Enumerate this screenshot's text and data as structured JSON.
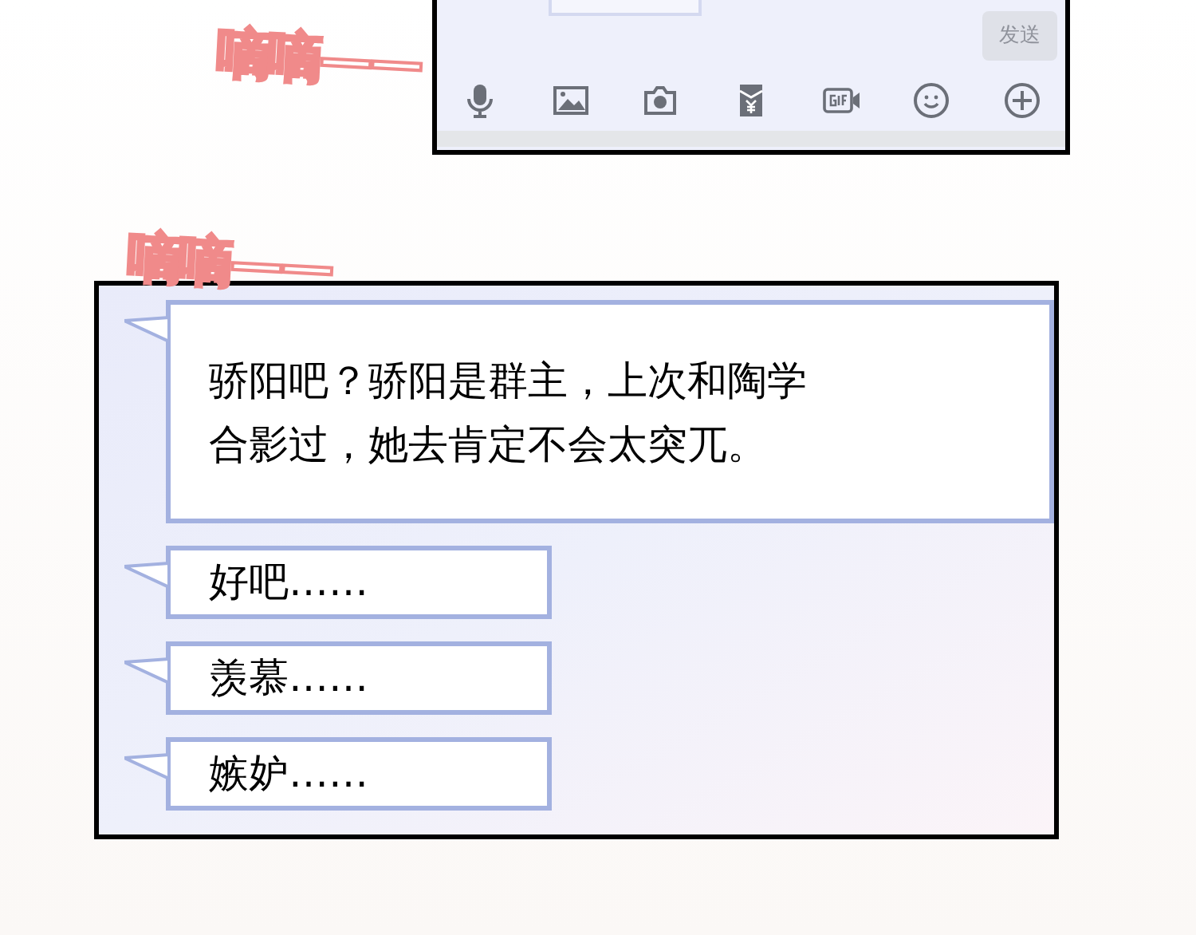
{
  "sound_effects": [
    "嘀嘀——",
    "嘀嘀——"
  ],
  "input_panel": {
    "send_button": {
      "label": "发送",
      "disabled": true
    },
    "toolbar": [
      {
        "kind": "mic"
      },
      {
        "kind": "image"
      },
      {
        "kind": "camera"
      },
      {
        "kind": "red_packet"
      },
      {
        "kind": "gif"
      },
      {
        "kind": "emoji"
      },
      {
        "kind": "plus"
      }
    ]
  },
  "chat_panel": {
    "messages": [
      {
        "lines": [
          "骄阳吧？骄阳是群主，上次和陶学",
          "合影过，她去肯定不会太突兀。"
        ]
      },
      {
        "lines": [
          "好吧……"
        ]
      },
      {
        "lines": [
          "羡慕……"
        ]
      },
      {
        "lines": [
          "嫉妒……"
        ]
      }
    ]
  }
}
